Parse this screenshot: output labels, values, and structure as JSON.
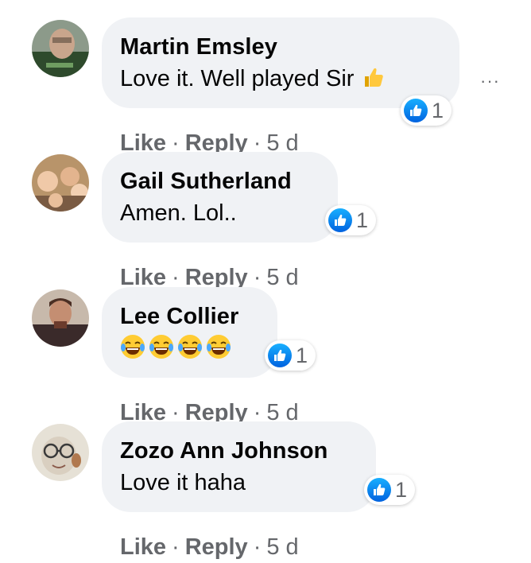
{
  "comments": [
    {
      "author": "Martin Emsley",
      "text": "Love it. Well played Sir",
      "reaction_count": "1",
      "actions": {
        "like": "Like",
        "reply": "Reply",
        "time": "5 d",
        "sep": "·"
      }
    },
    {
      "author": "Gail Sutherland",
      "text": "Amen. Lol..",
      "reaction_count": "1",
      "actions": {
        "like": "Like",
        "reply": "Reply",
        "time": "5 d",
        "sep": "·"
      }
    },
    {
      "author": "Lee Collier",
      "emoji": "😂😂😂😂",
      "reaction_count": "1",
      "actions": {
        "like": "Like",
        "reply": "Reply",
        "time": "5 d",
        "sep": "·"
      }
    },
    {
      "author": "Zozo Ann Johnson",
      "text": "Love it haha",
      "reaction_count": "1",
      "actions": {
        "like": "Like",
        "reply": "Reply",
        "time": "5 d",
        "sep": "·"
      }
    }
  ],
  "more_options": "···",
  "icons": {
    "thumbs_up_emoji": "thumbs-up-icon",
    "like_reaction": "like-reaction-icon",
    "laughing_emoji": "laughing-emoji-icon",
    "more": "more-options-icon"
  },
  "colors": {
    "bubble": "#f0f2f5",
    "secondary_text": "#65676b",
    "like_blue": "#1877f2"
  }
}
